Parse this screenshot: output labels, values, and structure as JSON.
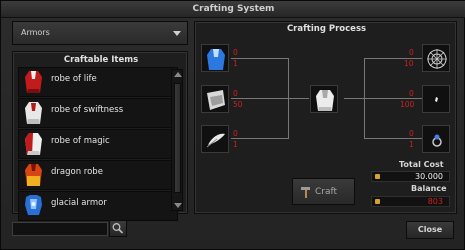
{
  "window": {
    "title": "Crafting System"
  },
  "category_dropdown": {
    "value": "Armors",
    "icon": "chevron-down-icon"
  },
  "craftable": {
    "title": "Craftable Items",
    "items": [
      {
        "label": "robe of life",
        "icon": "red-robe-icon"
      },
      {
        "label": "robe of swiftness",
        "icon": "white-robe-icon"
      },
      {
        "label": "robe of magic",
        "icon": "red-white-robe-icon"
      },
      {
        "label": "dragon robe",
        "icon": "dragon-robe-icon"
      },
      {
        "label": "glacial armor",
        "icon": "blue-armor-icon"
      }
    ]
  },
  "process": {
    "title": "Crafting Process",
    "left_slots": [
      {
        "icon": "blue-robe-icon",
        "have": "0",
        "need": "1"
      },
      {
        "icon": "white-cloth-icon",
        "have": "0",
        "need": "50"
      },
      {
        "icon": "feather-icon",
        "have": "0",
        "need": "1"
      }
    ],
    "right_slots": [
      {
        "icon": "spider-web-icon",
        "have": "0",
        "need": "10"
      },
      {
        "icon": "small-shard-icon",
        "have": "0",
        "need": "100"
      },
      {
        "icon": "blue-ring-icon",
        "have": "0",
        "need": "1"
      }
    ],
    "result_icon": "white-robe-result-icon",
    "total_cost_label": "Total Cost",
    "total_cost": "30.000",
    "balance_label": "Balance",
    "balance": "803",
    "colors": {
      "need_red": "#cc2222",
      "cost_white": "#f2f2f2"
    }
  },
  "buttons": {
    "craft": "Craft",
    "close": "Close"
  },
  "search": {
    "placeholder": ""
  }
}
